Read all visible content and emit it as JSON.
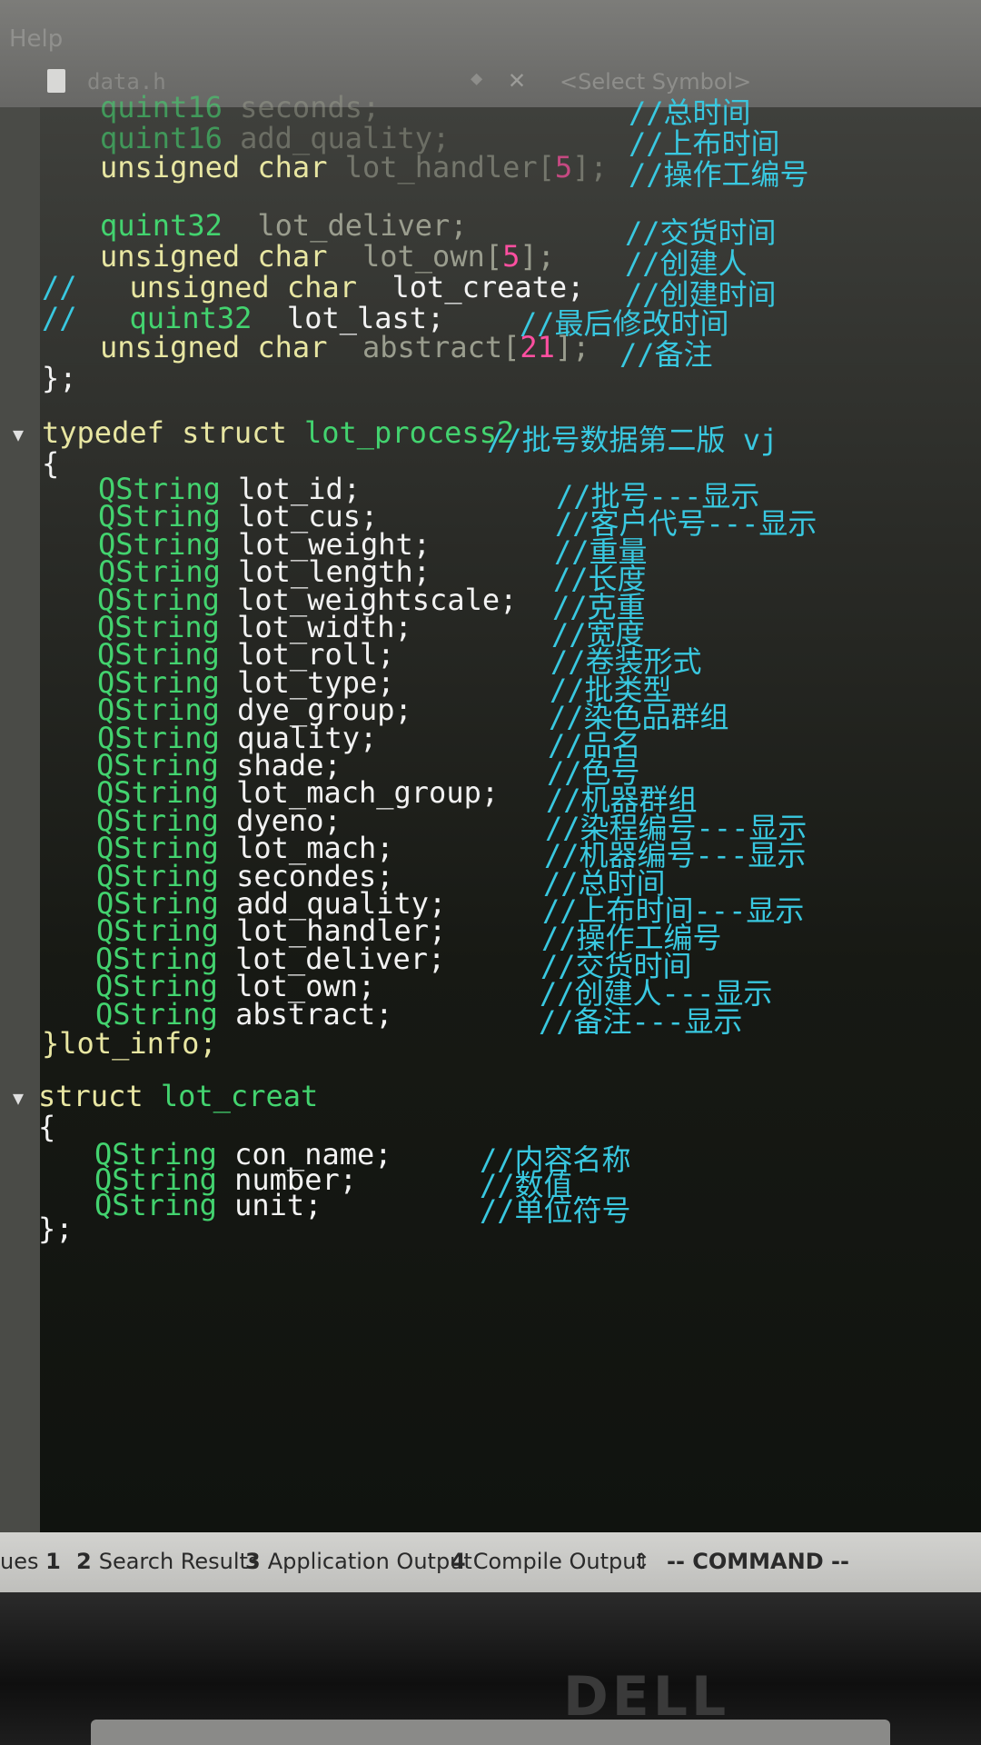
{
  "menu": {
    "help": "Help"
  },
  "tab": {
    "file_name": "data.h",
    "symbol_placeholder": "<Select Symbol>"
  },
  "code": {
    "l01": [
      "quint16",
      " seconds;",
      "//总时间"
    ],
    "l02": [
      "quint16",
      " add_quality;",
      "//上布时间"
    ],
    "l03": [
      "unsigned char",
      " lot_handler[",
      "5",
      "];",
      "//操作工编号"
    ],
    "l04": [
      "quint32",
      "  lot_deliver;",
      "//交货时间"
    ],
    "l05": [
      "unsigned char",
      "  lot_own[",
      "5",
      "];",
      "//创建人"
    ],
    "l06": [
      "//",
      "unsigned char",
      "  lot_create;",
      "//创建时间"
    ],
    "l07": [
      "//",
      "quint32",
      "  lot_last;",
      "//最后修改时间"
    ],
    "l08": [
      "unsigned char",
      "  abstract[",
      "21",
      "];",
      "//备注"
    ],
    "l09": [
      "};"
    ],
    "l10": [
      "typedef struct",
      " lot_process2",
      "//批号数据第二版 vj"
    ],
    "l11": [
      "{"
    ],
    "s2": [
      {
        "f": " lot_id;",
        "c": "//批号---显示"
      },
      {
        "f": " lot_cus;",
        "c": "//客户代号---显示"
      },
      {
        "f": " lot_weight;",
        "c": "//重量"
      },
      {
        "f": " lot_length;",
        "c": "//长度"
      },
      {
        "f": " lot_weightscale;",
        "c": "//克重"
      },
      {
        "f": " lot_width;",
        "c": "//宽度"
      },
      {
        "f": " lot_roll;",
        "c": "//卷装形式"
      },
      {
        "f": " lot_type;",
        "c": "//批类型"
      },
      {
        "f": " dye_group;",
        "c": "//染色品群组"
      },
      {
        "f": " quality;",
        "c": "//品名"
      },
      {
        "f": " shade;",
        "c": "//色号"
      },
      {
        "f": " lot_mach_group;",
        "c": "//机器群组"
      },
      {
        "f": " dyeno;",
        "c": "//染程编号---显示"
      },
      {
        "f": " lot_mach;",
        "c": "//机器编号---显示"
      },
      {
        "f": " secondes;",
        "c": "//总时间"
      },
      {
        "f": " add_quality;",
        "c": "//上布时间---显示"
      },
      {
        "f": " lot_handler;",
        "c": "//操作工编号"
      },
      {
        "f": " lot_deliver;",
        "c": "//交货时间"
      },
      {
        "f": " lot_own;",
        "c": "//创建人---显示"
      },
      {
        "f": " abstract;",
        "c": "//备注---显示"
      }
    ],
    "qstring": "QString",
    "lot_info": "}lot_info;",
    "struct_kw": "struct",
    "struct_name": " lot_creat",
    "open_brace": "{",
    "s3": [
      {
        "f": " con_name;",
        "c": "//内容名称"
      },
      {
        "f": " number;",
        "c": "//数值"
      },
      {
        "f": " unit;",
        "c": "//单位符号"
      }
    ],
    "close": "};"
  },
  "output_pane": {
    "issues": "ues",
    "issues_num": "1",
    "search_num": "2",
    "search": "Search Results",
    "app_num": "3",
    "app": "Application Output",
    "compile_num": "4",
    "compile": "Compile Output",
    "mode": "-- COMMAND --"
  },
  "brand": "DELL",
  "colors": {
    "keyword": "#e8e6a2",
    "type": "#43d36f",
    "comment": "#39c8e0",
    "number": "#ff4fa0"
  }
}
